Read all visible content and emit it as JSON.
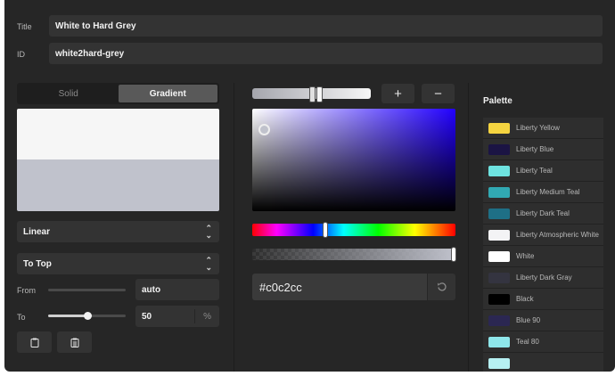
{
  "form": {
    "title_label": "Title",
    "title_value": "White to Hard Grey",
    "id_label": "ID",
    "id_value": "white2hard-grey"
  },
  "mode": {
    "solid_label": "Solid",
    "gradient_label": "Gradient",
    "selected": "Gradient"
  },
  "gradient": {
    "stop_colors": [
      "#f6f6f6",
      "#c0c2cc"
    ],
    "type_value": "Linear",
    "direction_value": "To Top",
    "from_label": "From",
    "from_value": "auto",
    "to_label": "To",
    "to_value": "50",
    "to_unit": "%",
    "to_slider_fraction": 0.5
  },
  "picker": {
    "add_label": "+",
    "remove_label": "−",
    "hex_value": "#c0c2cc",
    "hue_color": "#2200ff",
    "hue_fraction": 0.36,
    "alpha_fraction": 1.0
  },
  "palette": {
    "title": "Palette",
    "items": [
      {
        "name": "Liberty Yellow",
        "color": "#f5d440"
      },
      {
        "name": "Liberty Blue",
        "color": "#1b1444"
      },
      {
        "name": "Liberty Teal",
        "color": "#6ee3e0"
      },
      {
        "name": "Liberty Medium Teal",
        "color": "#31a9b3"
      },
      {
        "name": "Liberty Dark Teal",
        "color": "#1e6f86"
      },
      {
        "name": "Liberty Atmospheric White",
        "color": "#f3f3f5"
      },
      {
        "name": "White",
        "color": "#ffffff"
      },
      {
        "name": "Liberty Dark Gray",
        "color": "#343440"
      },
      {
        "name": "Black",
        "color": "#000000"
      },
      {
        "name": "Blue 90",
        "color": "#2b2752"
      },
      {
        "name": "Teal 80",
        "color": "#8ee6ea"
      },
      {
        "name": "",
        "color": "#b6f0f2"
      }
    ]
  }
}
